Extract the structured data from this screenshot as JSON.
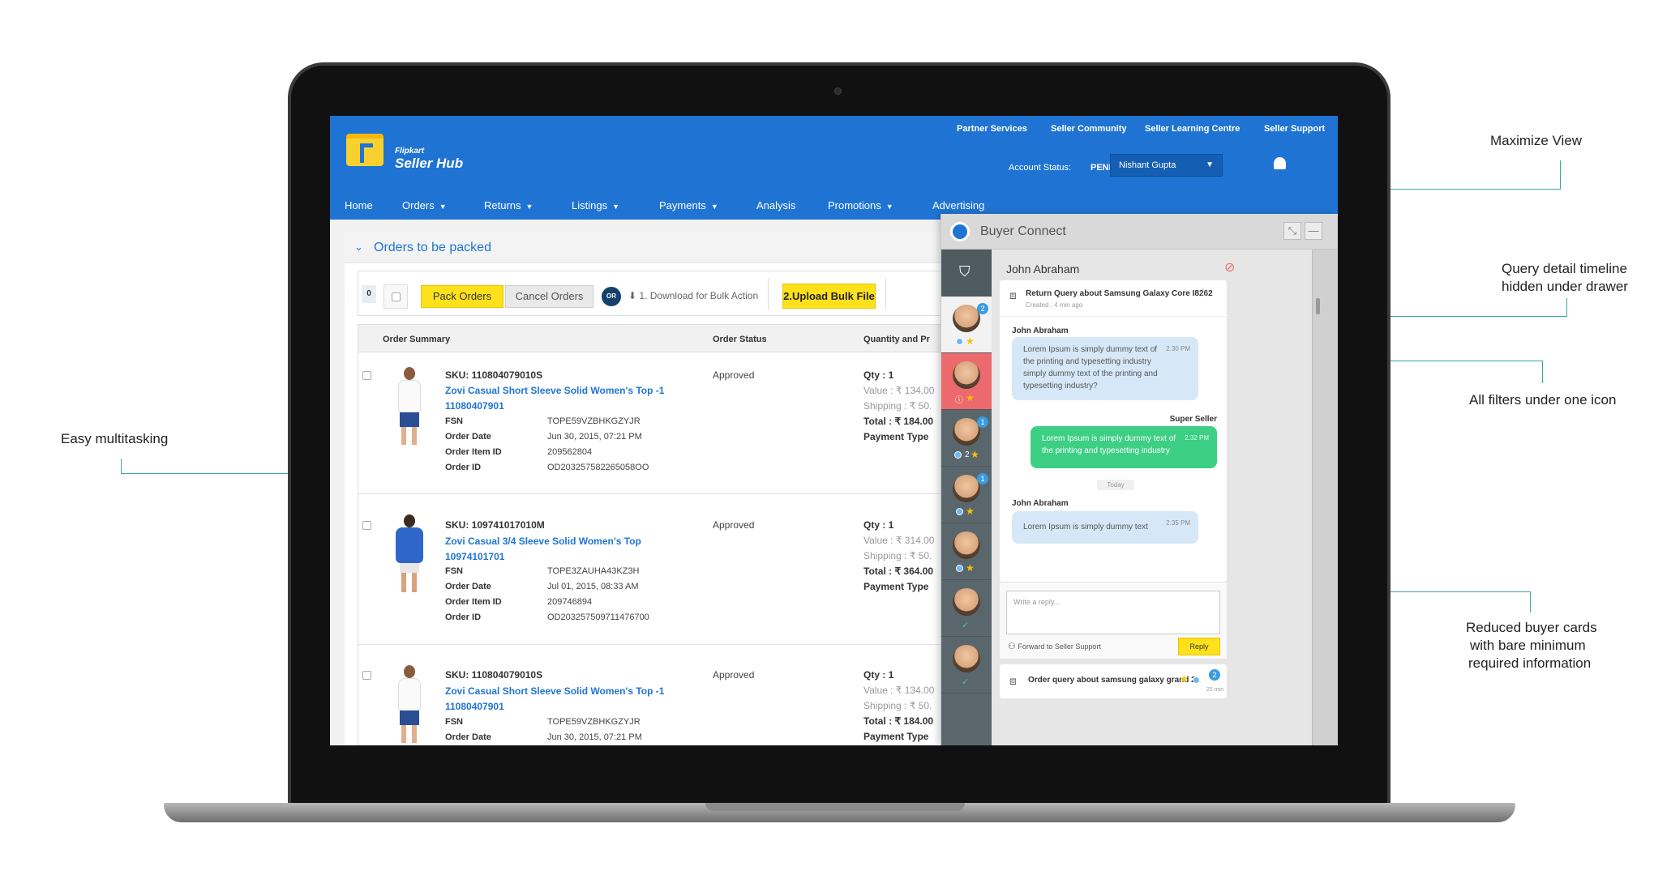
{
  "annotations": {
    "maximize": "Maximize View",
    "timeline_line1": "Query detail timeline",
    "timeline_line2": "hidden under drawer",
    "filters": "All filters under one icon",
    "multitask": "Easy multitasking",
    "cards_line1": "Reduced buyer cards",
    "cards_line2": "with bare minimum",
    "cards_line3": "required information"
  },
  "header": {
    "logo_small": "Flipkart",
    "logo_big": "Seller Hub",
    "top_links": [
      "Partner Services",
      "Seller Community",
      "Seller Learning Centre",
      "Seller Support"
    ],
    "account_status_label": "Account Status:",
    "account_status_value": "PENDING",
    "user_name": "Nishant Gupta",
    "nav": [
      "Home",
      "Orders",
      "Returns",
      "Listings",
      "Payments",
      "Analysis",
      "Promotions",
      "Advertising"
    ]
  },
  "section": {
    "title": "Orders to be packed",
    "count": "0",
    "pack_orders": "Pack Orders",
    "cancel_orders": "Cancel Orders",
    "or": "OR",
    "download": "1. Download for Bulk Action",
    "upload": "2.Upload Bulk File"
  },
  "table": {
    "headers": [
      "Order Summary",
      "Order Status",
      "Quantity and Pr"
    ],
    "field_labels": {
      "fsn": "FSN",
      "order_date": "Order Date",
      "order_item_id": "Order Item ID",
      "order_id": "Order ID",
      "payment_type": "Payment Type"
    },
    "rows": [
      {
        "sku": "SKU: 110804079010S",
        "title1": "Zovi Casual Short Sleeve Solid Women's Top -1",
        "title2": "11080407901",
        "status": "Approved",
        "fsn": "TOPE59VZBHKGZYJR",
        "order_date": "Jun 30, 2015, 07:21 PM",
        "order_item_id": "209562804",
        "order_id": "OD203257582265058OO",
        "qty": "Qty : 1",
        "value": "Value : ₹ 134.00",
        "shipping": "Shipping : ₹ 50.",
        "total": "Total : ₹ 184.00"
      },
      {
        "sku": "SKU: 109741017010M",
        "title1": "Zovi Casual 3/4 Sleeve Solid Women's Top",
        "title2": "10974101701",
        "status": "Approved",
        "fsn": "TOPE3ZAUHA43KZ3H",
        "order_date": "Jul 01, 2015, 08:33 AM",
        "order_item_id": "209746894",
        "order_id": "OD203257509711476700",
        "qty": "Qty : 1",
        "value": "Value : ₹ 314.00",
        "shipping": "Shipping : ₹ 50.",
        "total": "Total : ₹ 364.00"
      },
      {
        "sku": "SKU: 110804079010S",
        "title1": "Zovi Casual Short Sleeve Solid Women's Top -1",
        "title2": "11080407901",
        "status": "Approved",
        "fsn": "TOPE59VZBHKGZYJR",
        "order_date": "Jun 30, 2015, 07:21 PM",
        "qty": "Qty : 1",
        "value": "Value : ₹ 134.00",
        "shipping": "Shipping : ₹ 50.",
        "total": "Total : ₹ 184.00"
      }
    ]
  },
  "chat": {
    "title": "Buyer Connect",
    "buyer_name": "John Abraham",
    "query_title": "Return Query about Samsung Galaxy Core I8262",
    "query_created": "Created : 4 min ago",
    "messages": [
      {
        "sender": "John Abraham",
        "text": "Lorem Ipsum is simply dummy text of the printing and typesetting industry simply dummy text of the printing and typesetting industry?",
        "time": "2.30 PM"
      },
      {
        "sender": "Super Seller",
        "text": "Lorem Ipsum is simply dummy text of the printing and typesetting industry",
        "time": "2.32 PM"
      },
      {
        "sender": "John Abraham",
        "text": "Lorem Ipsum is simply dummy text",
        "time": "2.35 PM"
      }
    ],
    "divider": "Today",
    "reply_placeholder": "Write a reply...",
    "forward": "Forward to Seller Support",
    "reply_button": "Reply",
    "next_query_title": "Order query about samsung galaxy grand 2",
    "next_query_badge": "2",
    "next_query_time": "25 min",
    "buyer_badges": [
      "2",
      "1",
      "1"
    ],
    "card_rating_2": "2"
  },
  "colors": {
    "brand_blue": "#1f74d3",
    "yellow": "#ffe11b",
    "rail": "#59676d",
    "alert_red": "#ec6a6e",
    "green_bubble": "#3dcf84",
    "blue_bubble": "#d6e8f7",
    "annotation_line": "#3aa7a3"
  }
}
